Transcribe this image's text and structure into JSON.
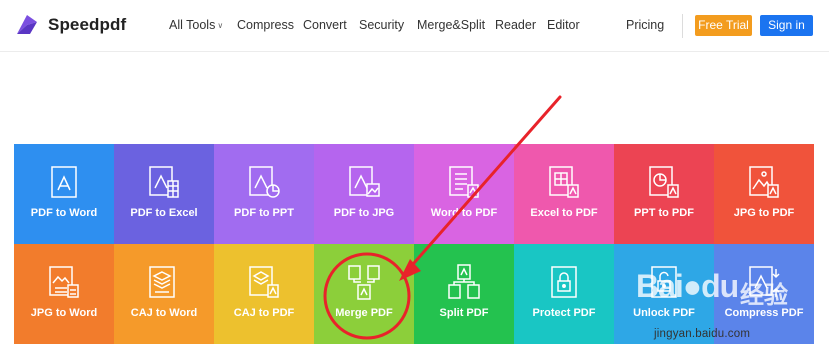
{
  "header": {
    "brand": "Speedpdf",
    "nav": [
      {
        "label": "All Tools",
        "has_dropdown": true
      },
      {
        "label": "Compress"
      },
      {
        "label": "Convert"
      },
      {
        "label": "Security"
      },
      {
        "label": "Merge&Split"
      },
      {
        "label": "Reader"
      },
      {
        "label": "Editor"
      },
      {
        "label": "Pricing"
      }
    ],
    "free_trial": "Free Trial",
    "sign_in": "Sign in"
  },
  "tools": [
    {
      "label": "PDF to Word",
      "color": "#2e8ff0",
      "icon": "pdf-file-icon"
    },
    {
      "label": "PDF to Excel",
      "color": "#6b62e0",
      "icon": "pdf-excel-icon"
    },
    {
      "label": "PDF to PPT",
      "color": "#a16cf0",
      "icon": "pdf-ppt-icon"
    },
    {
      "label": "PDF to JPG",
      "color": "#b565ee",
      "icon": "pdf-image-icon"
    },
    {
      "label": "Word to PDF",
      "color": "#d964e2",
      "icon": "word-document-icon"
    },
    {
      "label": "Excel to PDF",
      "color": "#ef58ad",
      "icon": "excel-grid-icon"
    },
    {
      "label": "PPT to PDF",
      "color": "#ec4453",
      "icon": "ppt-chart-icon"
    },
    {
      "label": "JPG to PDF",
      "color": "#f0533b",
      "icon": "jpg-image-icon"
    },
    {
      "label": "JPG to Word",
      "color": "#f27c2c",
      "icon": "jpg-word-icon"
    },
    {
      "label": "CAJ to Word",
      "color": "#f59a2a",
      "icon": "caj-word-icon"
    },
    {
      "label": "CAJ to PDF",
      "color": "#edc12e",
      "icon": "caj-layers-icon"
    },
    {
      "label": "Merge PDF",
      "color": "#8ccf3a",
      "icon": "merge-pdf-icon"
    },
    {
      "label": "Split PDF",
      "color": "#24c24f",
      "icon": "split-pdf-icon"
    },
    {
      "label": "Protect PDF",
      "color": "#19c6c4",
      "icon": "lock-pdf-icon"
    },
    {
      "label": "Unlock PDF",
      "color": "#2ea7e6",
      "icon": "unlock-pdf-icon"
    },
    {
      "label": "Compress PDF",
      "color": "#5b84ea",
      "icon": "compress-pdf-icon"
    }
  ],
  "annotation": {
    "stroke_color": "#e8232a"
  },
  "watermark": {
    "logo": "Bai",
    "logo_tail": "du",
    "cn": "经验",
    "url": "jingyan.baidu.com"
  }
}
